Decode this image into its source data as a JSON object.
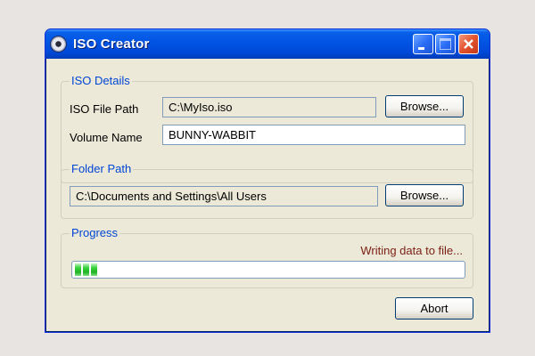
{
  "window": {
    "title": "ISO Creator"
  },
  "iso_details": {
    "group_label": "ISO Details",
    "file_path_label": "ISO File Path",
    "file_path_value": "C:\\MyIso.iso",
    "browse_label": "Browse...",
    "volume_name_label": "Volume Name",
    "volume_name_value": "BUNNY-WABBIT"
  },
  "folder": {
    "group_label": "Folder Path",
    "path_value": "C:\\Documents and Settings\\All Users",
    "browse_label": "Browse..."
  },
  "progress": {
    "group_label": "Progress",
    "status_text": "Writing data to file...",
    "fraction": 0.07,
    "color": "#21b125"
  },
  "actions": {
    "abort_label": "Abort"
  },
  "icons": {
    "app": "disc-icon",
    "minimize": "minimize-icon",
    "maximize": "maximize-icon",
    "close": "close-icon"
  }
}
